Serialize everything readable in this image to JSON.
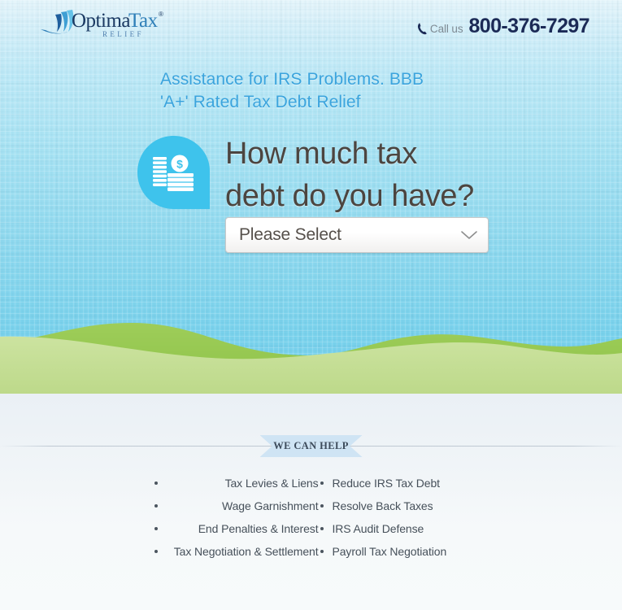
{
  "header": {
    "logo": {
      "name": "OptimaTax",
      "word_optima": "Optima",
      "word_tax": "Tax",
      "trademark": "®",
      "subtitle": "RELIEF",
      "swoosh_icon": "wave-swoosh-icon"
    },
    "phone": {
      "icon": "phone-handset-icon",
      "call_label": "Call us",
      "number": "800-376-7297"
    }
  },
  "hero": {
    "subheadline": "Assistance for IRS Problems. BBB 'A+' Rated Tax Debt Relief",
    "subheadline_line1": "Assistance for IRS Problems. BBB",
    "subheadline_line2": "'A+' Rated Tax Debt Relief",
    "bubble_icon": "money-stack-pin-icon",
    "headline": "How much tax debt do you have?",
    "headline_line1": "How much tax",
    "headline_line2": "debt do you have?",
    "select": {
      "name": "tax-debt-amount-select",
      "value": "Please Select",
      "placeholder": "Please Select",
      "chevron_icon": "chevron-down-icon"
    }
  },
  "lower": {
    "ribbon_label": "WE CAN HELP",
    "help_left": [
      "Tax Levies & Liens",
      "Wage Garnishment",
      "End Penalties & Interest",
      "Tax Negotiation & Settlement"
    ],
    "help_right": [
      "Reduce IRS Tax Debt",
      "Resolve Back Taxes",
      "IRS Audit Defense",
      "Payroll Tax Negotiation"
    ]
  },
  "colors": {
    "sky_top": "#e4f4fa",
    "sky_bottom": "#74d0ec",
    "accent_blue": "#3ba4dd",
    "bubble_blue": "#3ec3ec",
    "hill_back": "#97c953",
    "hill_front": "#c4dd94",
    "headline_gray": "#4c4540",
    "phone_navy": "#1b2a56",
    "ribbon_blue": "#cfe4f4",
    "lower_bg": "#f2f6f9"
  }
}
